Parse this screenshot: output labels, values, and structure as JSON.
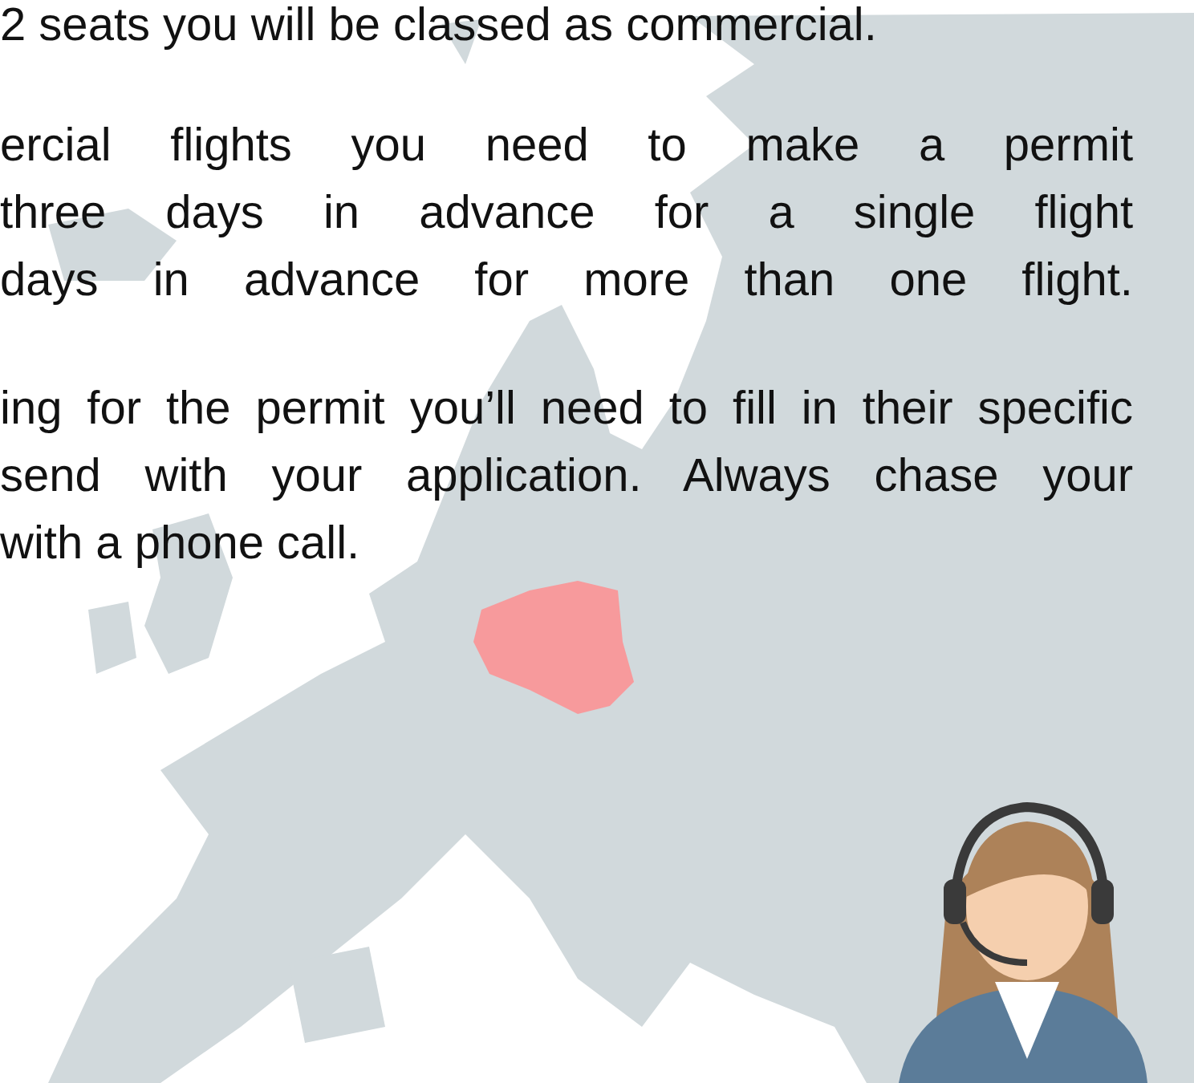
{
  "paragraphs": [
    {
      "lines": [
        {
          "text": "2 seats you will be classed as commercial.",
          "justified": false
        }
      ]
    },
    {
      "lines": [
        {
          "text": "ercial flights you need to make a permit",
          "justified": true
        },
        {
          "text": "three days in advance for a single flight",
          "justified": true
        },
        {
          "text": "days in advance for more than one flight.",
          "justified": true
        }
      ]
    },
    {
      "lines": [
        {
          "text": "ing for the permit you’ll need to fill in their specific",
          "justified": true
        },
        {
          "text": "send with your application. Always chase your",
          "justified": true
        },
        {
          "text": "with a phone call.",
          "justified": false
        }
      ]
    }
  ]
}
